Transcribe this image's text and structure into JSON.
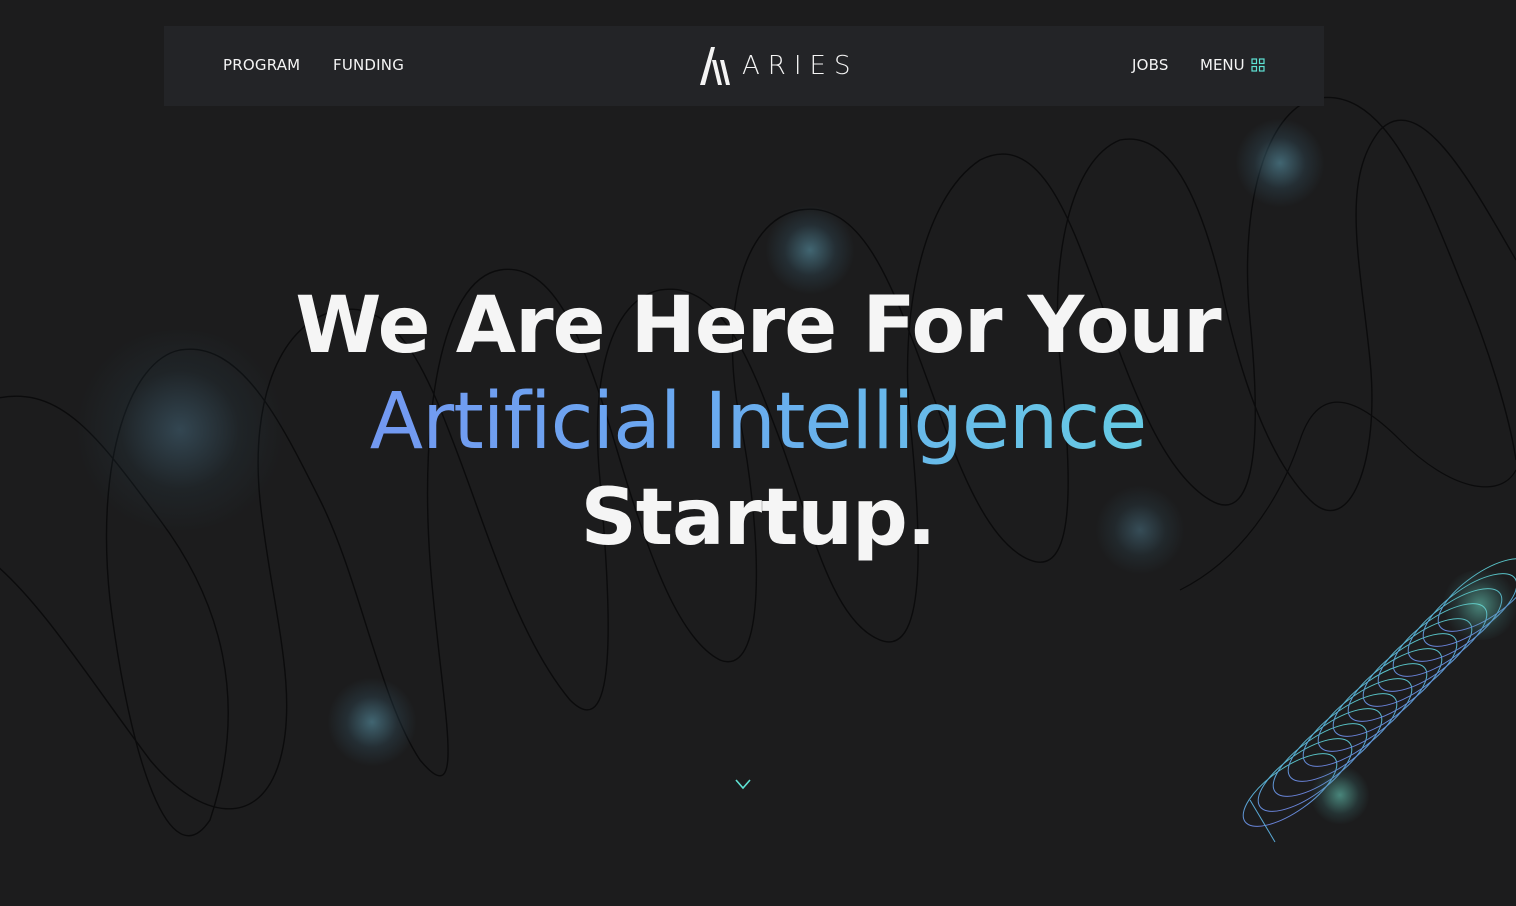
{
  "nav": {
    "left_links": [
      "PROGRAM",
      "FUNDING"
    ],
    "right_links": [
      "JOBS"
    ],
    "menu_label": "MENU",
    "logo_text": "ARIES"
  },
  "hero": {
    "line1": "We Are Here For Your",
    "line2": "Artificial Intelligence",
    "line3": "Startup."
  },
  "icons": {
    "logo": "aries-logo-icon",
    "menu": "grid-icon",
    "scroll": "arrow-down-icon"
  },
  "colors": {
    "background": "#1c1c1d",
    "navbar": "#232427",
    "gradient_start": "#7d86f2",
    "gradient_end": "#63e6da",
    "accent_teal": "#5fe3d4"
  }
}
